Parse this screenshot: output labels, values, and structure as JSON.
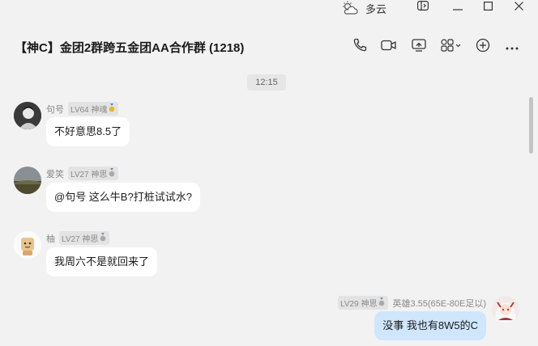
{
  "weather": {
    "icon": "cloud-sun-icon",
    "text": "多云"
  },
  "window_controls": [
    "pin-window-icon",
    "minimize-icon",
    "maximize-icon",
    "close-icon"
  ],
  "header": {
    "title": "【神C】金团2群跨五金团AA合作群 (1218)",
    "toolbar_icons": [
      "phone-icon",
      "video-icon",
      "screen-share-icon",
      "apps-grid-icon",
      "add-icon",
      "more-icon"
    ]
  },
  "chat": {
    "time_divider": "12:15",
    "messages": [
      {
        "sender": "句号",
        "level": "LV64 神魂",
        "medal": "gold-medal-icon",
        "text": "不好意思8.5了"
      },
      {
        "sender": "爱笑",
        "level": "LV27 神思",
        "medal": "silver-medal-icon",
        "text": "@句号  这么牛B?打桩试试水?"
      },
      {
        "sender": "柚",
        "level": "LV27 神思",
        "medal": "silver-medal-icon",
        "text": "我周六不是就回来了"
      },
      {
        "sender": "英雄3.55(65E-80E足以)",
        "level": "LV29 神思",
        "medal": "silver-medal-icon",
        "text": "没事 我也有8W5的C",
        "self": true
      }
    ]
  },
  "colors": {
    "background": "#f2f2f2",
    "bubble": "#ffffff",
    "self_bubble": "#cfe6fd",
    "badge": "#e3e3e3"
  }
}
